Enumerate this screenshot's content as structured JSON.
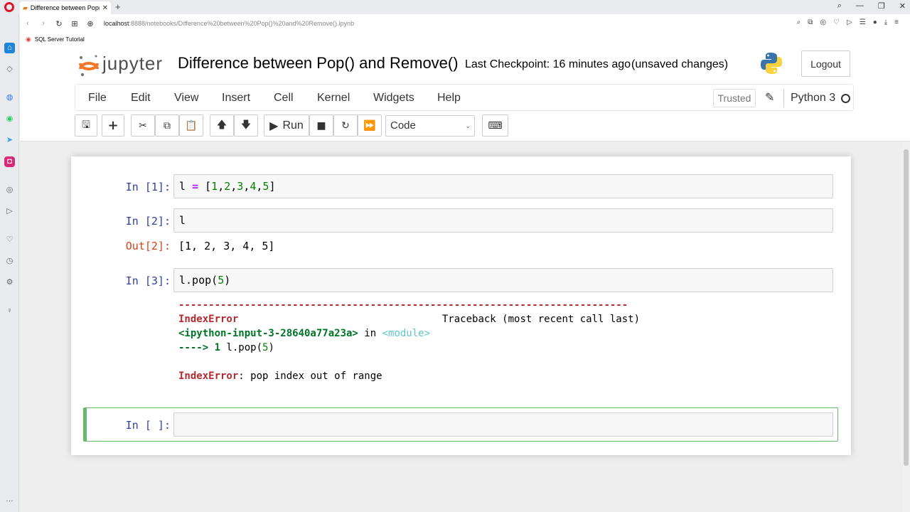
{
  "browser": {
    "tab_title": "Difference between Pop() a",
    "new_tab": "+",
    "url_host": "localhost",
    "url_rest": ":8888/notebooks/Difference%20between%20Pop()%20and%20Remove().ipynb",
    "bookmark": "SQL Server Tutorial"
  },
  "header": {
    "jupyter_text": "jupyter",
    "notebook_title": "Difference between Pop() and Remove()",
    "checkpoint": "Last Checkpoint: 16 minutes ago",
    "unsaved": "(unsaved changes)",
    "logout": "Logout"
  },
  "menu": {
    "items": [
      "File",
      "Edit",
      "View",
      "Insert",
      "Cell",
      "Kernel",
      "Widgets",
      "Help"
    ],
    "trusted": "Trusted",
    "kernel": "Python 3"
  },
  "toolbar": {
    "run_label": "Run",
    "cell_type": "Code"
  },
  "cells": {
    "c1": {
      "prompt": "In [1]:"
    },
    "c2": {
      "prompt": "In [2]:",
      "code": "l",
      "out_prompt": "Out[2]:",
      "output": "[1, 2, 3, 4, 5]"
    },
    "c3": {
      "prompt": "In [3]:",
      "code_a": "l.pop(",
      "code_num": "5",
      "code_b": ")",
      "dashes": "---------------------------------------------------------------------------",
      "err_name": "IndexError",
      "traceback_label": "Traceback (most recent call last)",
      "input_ref": "<ipython-input-3-28640a77a23a>",
      "in_word": " in ",
      "module": "<module>",
      "arrow": "----> 1",
      "arrow_code_a": " l.pop(",
      "arrow_code_num": "5",
      "arrow_code_b": ")",
      "err_name2": "IndexError",
      "err_msg": ": pop index out of range"
    },
    "c4": {
      "prompt": "In [ ]:"
    }
  }
}
